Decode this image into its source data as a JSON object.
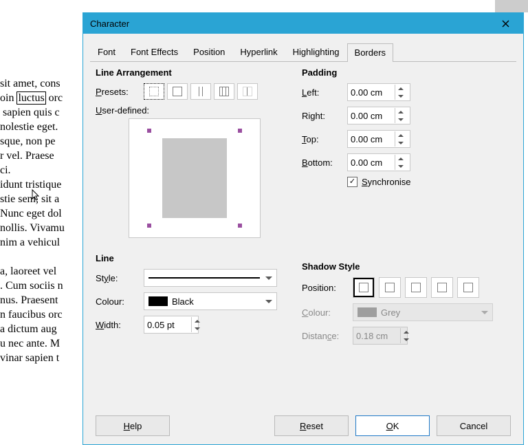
{
  "dialog": {
    "title": "Character",
    "tabs": [
      "Font",
      "Font Effects",
      "Position",
      "Hyperlink",
      "Highlighting",
      "Borders"
    ],
    "active_tab": 5
  },
  "line_arrangement": {
    "title": "Line Arrangement",
    "presets_label_pre": "P",
    "presets_label_post": "resets:",
    "user_defined_pre": "U",
    "user_defined_post": "ser-defined:"
  },
  "line": {
    "title": "Line",
    "style_pre": "St",
    "style_post": "yle:",
    "colour_label": "Colour:",
    "colour_value": "Black",
    "width_pre": "",
    "width_label": "Width:",
    "width_value": "0.05 pt"
  },
  "padding": {
    "title": "Padding",
    "left_pre": "L",
    "left_post": "eft:",
    "right_label": "Right:",
    "top_pre": "T",
    "top_post": "op:",
    "bottom_pre": "B",
    "bottom_post": "ottom:",
    "left_value": "0.00 cm",
    "right_value": "0.00 cm",
    "top_value": "0.00 cm",
    "bottom_value": "0.00 cm",
    "sync_pre": "S",
    "sync_post": "ynchronise"
  },
  "shadow": {
    "title": "Shadow Style",
    "position_label": "Position:",
    "colour_pre": "C",
    "colour_post": "olour:",
    "colour_value": "Grey",
    "distance_pre": "Distan",
    "distance_post": "ce:",
    "distance_value": "0.18 cm"
  },
  "footer": {
    "help_pre": "H",
    "help_post": "elp",
    "reset_pre": "R",
    "reset_post": "eset",
    "ok_pre": "O",
    "ok_post": "K",
    "cancel_label": "Cancel"
  },
  "bg_text": {
    "l1": "sit amet, cons",
    "l2a": "oin ",
    "l2b": "luctus",
    "l2c": " orc",
    "l3": " sapien quis c",
    "l4": "nolestie eget.",
    "l5": "sque, non pe",
    "l6": "r vel. Praese",
    "l7": "ci.",
    "l8": "idunt tristique ",
    "l9": "stie sem, sit a",
    "l10": "Nunc eget dol",
    "l11": "nollis. Vivamu",
    "l12": "nim a vehicul",
    "l13": "a, laoreet vel ",
    "l14": ". Cum sociis n",
    "l15": "nus. Praesent",
    "l16": "n faucibus orc",
    "l17": "a dictum aug",
    "l18": "u nec ante. M",
    "l19": "vinar sapien t"
  }
}
